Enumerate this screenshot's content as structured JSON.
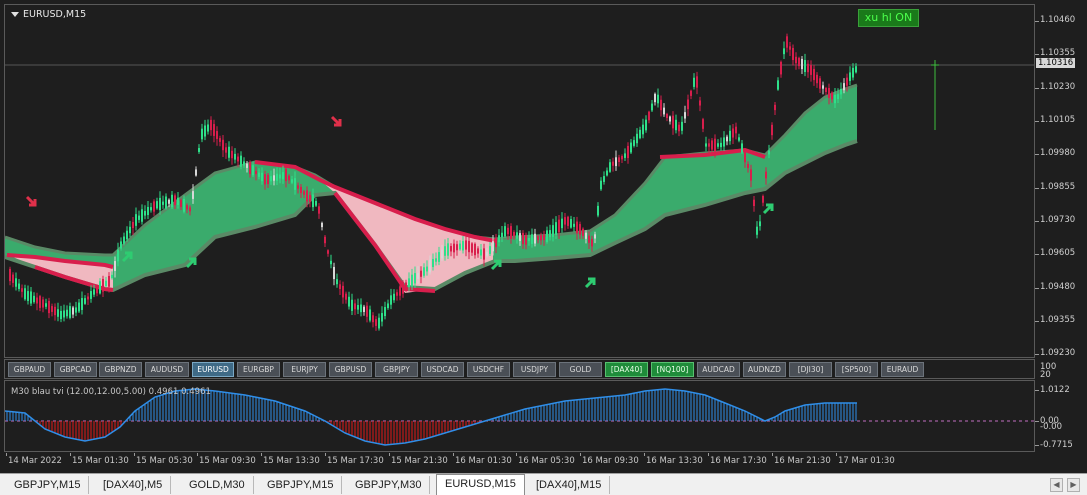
{
  "chart": {
    "title": "EURUSD,M15",
    "badge": "xu hl ON",
    "current_price": "1.10316",
    "price_labels": [
      "1.10460",
      "1.10355",
      "1.10230",
      "1.10105",
      "1.09980",
      "1.09855",
      "1.09730",
      "1.09605",
      "1.09480",
      "1.09355",
      "1.09230"
    ]
  },
  "symbols": [
    "GBPAUD",
    "GBPCAD",
    "GBPNZD",
    "AUDUSD",
    "EURUSD",
    "EURGBP",
    "EURJPY",
    "GBPUSD",
    "GBPJPY",
    "USDCAD",
    "USDCHF",
    "USDJPY",
    "GOLD",
    "[DAX40]",
    "[NQ100]",
    "AUDCAD",
    "AUDNZD",
    "[DJI30]",
    "[SP500]",
    "EURAUD"
  ],
  "active_symbol": "EURUSD",
  "green_symbols": [
    "[DAX40]",
    "[NQ100]"
  ],
  "symbol_scale": [
    "100",
    "20"
  ],
  "indicator": {
    "title": "M30  blau tvi (12.00,12.00,5.00)  0.4961 0.4961",
    "labels": [
      "1.0122",
      "0.00",
      "-0.00",
      "-0.7715"
    ]
  },
  "time_labels": [
    "14 Mar 2022",
    "15 Mar 01:30",
    "15 Mar 05:30",
    "15 Mar 09:30",
    "15 Mar 13:30",
    "15 Mar 17:30",
    "15 Mar 21:30",
    "16 Mar 01:30",
    "16 Mar 05:30",
    "16 Mar 09:30",
    "16 Mar 13:30",
    "16 Mar 17:30",
    "16 Mar 21:30",
    "17 Mar 01:30"
  ],
  "tabs": [
    "GBPJPY,M15",
    "[DAX40],M5",
    "GOLD,M30",
    "GBPJPY,M15",
    "GBPJPY,M30",
    "EURUSD,M15",
    "[DAX40],M15"
  ],
  "active_tab": "EURUSD,M15",
  "colors": {
    "bull": "#2ee08a",
    "bear": "#d81e4c",
    "doji": "#d8d8d8",
    "band_up": "#3cb371",
    "band_down": "#f0b8c0",
    "ind_up": "#2f8ee8",
    "ind_down": "#e01818",
    "zero": "#c06fc0"
  }
}
